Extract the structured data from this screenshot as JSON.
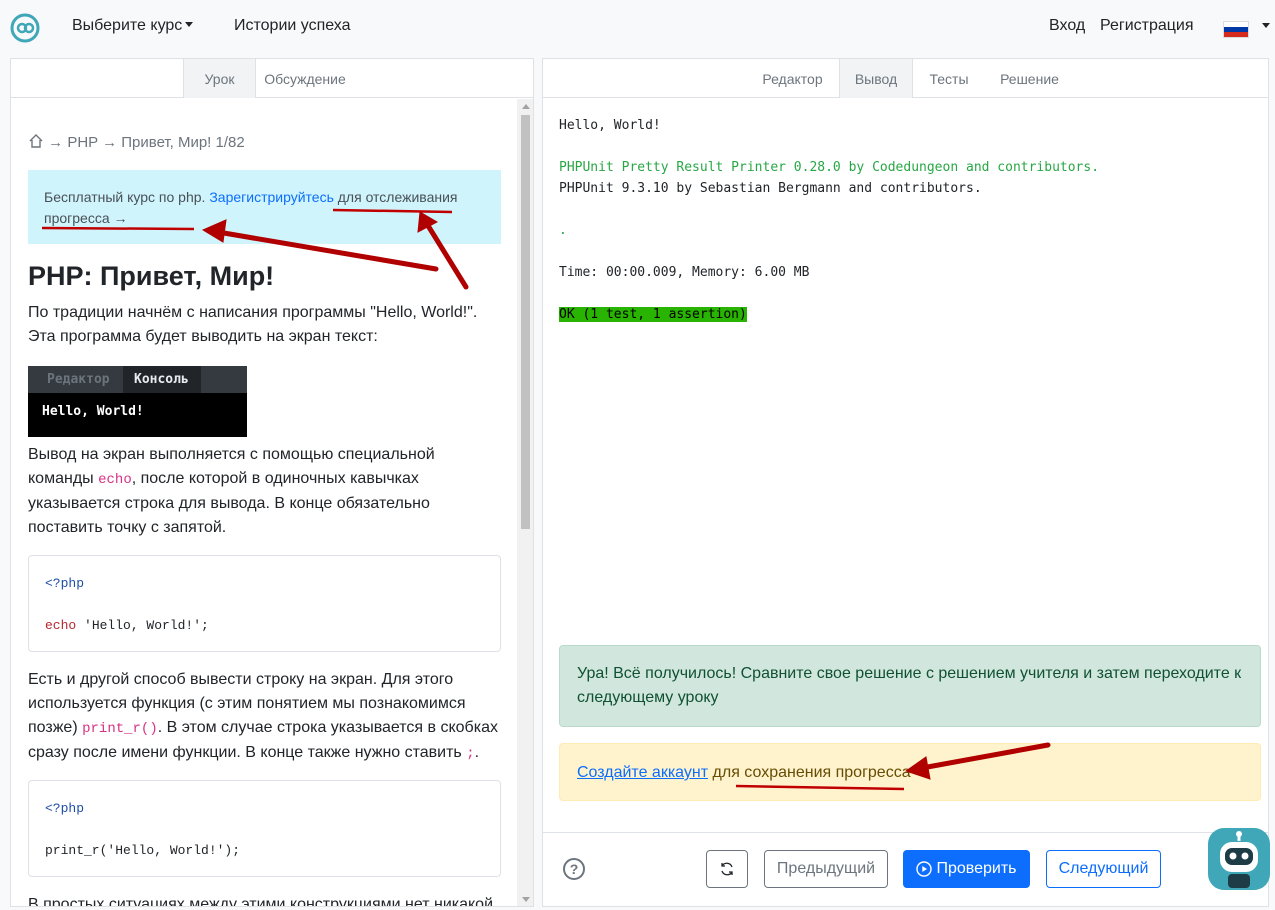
{
  "topnav": {
    "courses_label": "Выберите курс",
    "stories_label": "Истории успеха",
    "login_label": "Вход",
    "register_label": "Регистрация"
  },
  "left": {
    "tabs": {
      "lesson": "Урок",
      "discussion": "Обсуждение"
    },
    "breadcrumb": {
      "arrow1": "→",
      "lang": "PHP",
      "arrow2": "→",
      "lesson": "Привет, Мир! 1/82"
    },
    "alert": {
      "prefix": "Бесплатный курс по php.",
      "link": "Зарегистрируйтесь",
      "suffix": "для отслеживания прогресса →"
    },
    "title": "PHP: Привет, Мир!",
    "p1": "По традиции начнём с написания программы \"Hello, World!\". Эта программа будет выводить на экран текст:",
    "console": {
      "tab_editor": "Редактор",
      "tab_console": "Консоль",
      "output": "Hello, World!"
    },
    "p2_a": "Вывод на экран выполняется с помощью специальной команды",
    "p2_code": "echo",
    "p2_b": ", после которой в одиночных кавычках указывается строка для вывода. В конце обязательно поставить точку с запятой.",
    "code1": {
      "open": "<?php",
      "kw": "echo",
      "rest": " 'Hello, World!';"
    },
    "p3_a": "Есть и другой способ вывести строку на экран. Для этого используется функция (с этим понятием мы познакомимся позже)",
    "p3_code": "print_r()",
    "p3_b": ". В этом случае строка указывается в скобках сразу после имени функции. В конце также нужно ставить",
    "p3_code2": ";",
    "p3_c": ".",
    "code2": {
      "open": "<?php",
      "line": "print_r('Hello, World!');"
    },
    "p4": "В простых ситуациях между этими конструкциями нет никакой"
  },
  "right": {
    "tabs": {
      "editor": "Редактор",
      "output": "Вывод",
      "tests": "Тесты",
      "solution": "Решение"
    },
    "output": {
      "line1": "Hello, World!",
      "line2": "PHPUnit Pretty Result Printer 0.28.0 by Codedungeon and contributors.",
      "line3": "PHPUnit 9.3.10 by Sebastian Bergmann and contributors.",
      "line4": ".",
      "line5": "Time: 00:00.009, Memory: 6.00 MB",
      "line6": "OK (1 test, 1 assertion)"
    },
    "success": "Ура! Всё получилось! Сравните свое решение с решением учителя и затем переходите к следующему уроку",
    "warning": {
      "link": "Создайте аккаунт",
      "rest": "для сохранения прогресса"
    },
    "buttons": {
      "help": "?",
      "prev": "Предыдущий",
      "check": "Проверить",
      "next": "Следующий"
    }
  },
  "colors": {
    "accent": "#0d6efd",
    "success_bg": "#d1e7dd",
    "warning_bg": "#fff3cd",
    "info_bg": "#cff4fc",
    "annotation": "#c00000"
  }
}
